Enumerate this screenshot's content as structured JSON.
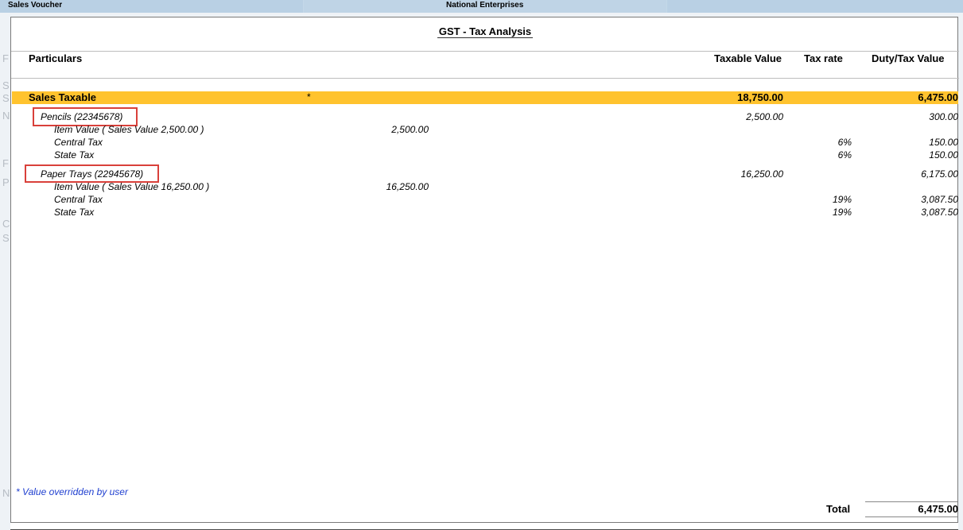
{
  "window": {
    "left_title": "Sales Voucher",
    "center_title": "National Enterprises"
  },
  "background_letters": [
    "F",
    "S",
    "S",
    "N",
    "F",
    "P",
    "C",
    "S",
    "N"
  ],
  "dialog": {
    "title": "GST - Tax Analysis",
    "columns": {
      "particulars": "Particulars",
      "taxable_value": "Taxable Value",
      "tax_rate": "Tax rate",
      "duty_value": "Duty/Tax Value"
    },
    "group": {
      "label": "Sales Taxable",
      "marker": "*",
      "taxable_value": "18,750.00",
      "duty_value": "6,475.00"
    },
    "items": [
      {
        "name": "Pencils (22345678)",
        "taxable_value": "2,500.00",
        "duty_value": "300.00",
        "item_value_label": "Item Value ( Sales Value 2,500.00 )",
        "item_value": "2,500.00",
        "central_tax_label": "Central Tax",
        "central_rate": "6%",
        "central_value": "150.00",
        "state_tax_label": "State Tax",
        "state_rate": "6%",
        "state_value": "150.00"
      },
      {
        "name": "Paper Trays (22945678)",
        "taxable_value": "16,250.00",
        "duty_value": "6,175.00",
        "item_value_label": "Item Value ( Sales Value 16,250.00 )",
        "item_value": "16,250.00",
        "central_tax_label": "Central Tax",
        "central_rate": "19%",
        "central_value": "3,087.50",
        "state_tax_label": "State Tax",
        "state_rate": "19%",
        "state_value": "3,087.50"
      }
    ],
    "footnote": "* Value overridden by user",
    "total_label": "Total",
    "total_value": "6,475.00"
  },
  "colors": {
    "highlight_band": "#ffc32e",
    "annotation_box": "#d9403a",
    "footnote": "#1f3fd0",
    "titlebar": "#c4d8e8"
  }
}
